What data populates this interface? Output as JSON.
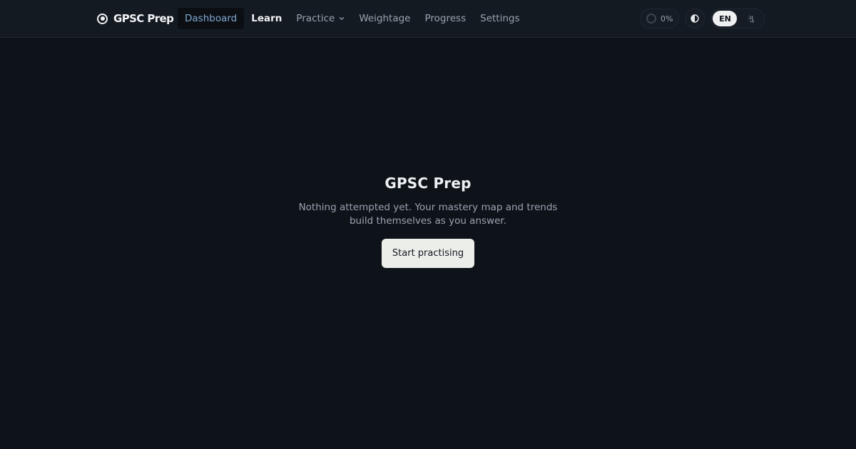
{
  "brand": {
    "name": "GPSC Prep",
    "icon": "target-icon"
  },
  "nav": {
    "items": [
      {
        "label": "Dashboard",
        "active": true
      },
      {
        "label": "Learn"
      },
      {
        "label": "Practice",
        "has_dropdown": true
      },
      {
        "label": "Weightage"
      },
      {
        "label": "Progress"
      },
      {
        "label": "Settings"
      }
    ]
  },
  "toolbar": {
    "progress": {
      "label": "0%",
      "value": 0
    },
    "theme_icon": "contrast-icon",
    "languages": [
      {
        "label": "EN",
        "active": true
      },
      {
        "label": "ગુ",
        "active": false
      }
    ]
  },
  "empty_state": {
    "title": "GPSC Prep",
    "description": "Nothing attempted yet. Your mastery map and trends build themselves as you answer.",
    "cta_label": "Start practising"
  },
  "colors": {
    "background": "#0e131a",
    "topbar": "#141a22",
    "active_nav_text": "#7fa8cf",
    "button_bg": "#eceeea"
  }
}
